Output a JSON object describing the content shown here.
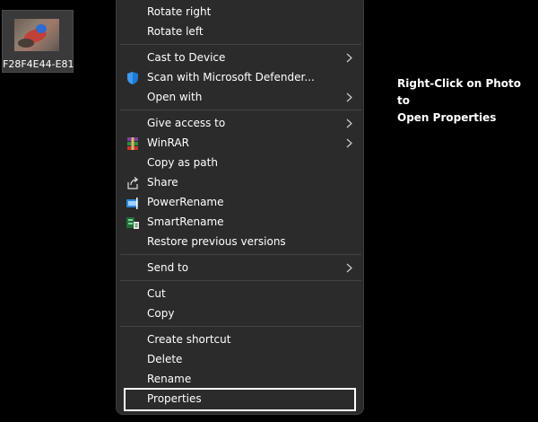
{
  "desktop": {
    "file": {
      "label": "F28F4E44-E81"
    }
  },
  "context_menu": {
    "items": [
      {
        "label": "Rotate right",
        "icon": "none",
        "submenu": false
      },
      {
        "label": "Rotate left",
        "icon": "none",
        "submenu": false
      },
      {
        "label": "Cast to Device",
        "icon": "none",
        "submenu": true
      },
      {
        "label": "Scan with Microsoft Defender...",
        "icon": "defender-shield-icon",
        "submenu": false
      },
      {
        "label": "Open with",
        "icon": "none",
        "submenu": true
      },
      {
        "label": "Give access to",
        "icon": "none",
        "submenu": true
      },
      {
        "label": "WinRAR",
        "icon": "winrar-icon",
        "submenu": true
      },
      {
        "label": "Copy as path",
        "icon": "none",
        "submenu": false
      },
      {
        "label": "Share",
        "icon": "share-icon",
        "submenu": false
      },
      {
        "label": "PowerRename",
        "icon": "powerrename-icon",
        "submenu": false
      },
      {
        "label": "SmartRename",
        "icon": "smartrename-icon",
        "submenu": false
      },
      {
        "label": "Restore previous versions",
        "icon": "none",
        "submenu": false
      },
      {
        "label": "Send to",
        "icon": "none",
        "submenu": true
      },
      {
        "label": "Cut",
        "icon": "none",
        "submenu": false
      },
      {
        "label": "Copy",
        "icon": "none",
        "submenu": false
      },
      {
        "label": "Create shortcut",
        "icon": "none",
        "submenu": false
      },
      {
        "label": "Delete",
        "icon": "none",
        "submenu": false
      },
      {
        "label": "Rename",
        "icon": "none",
        "submenu": false
      },
      {
        "label": "Properties",
        "icon": "none",
        "submenu": false,
        "highlighted": true
      }
    ]
  },
  "annotation": {
    "line1": "Right-Click on Photo to",
    "line2": "Open Properties"
  },
  "colors": {
    "menu_background": "#2b2b2b",
    "menu_text": "#ffffff",
    "separator": "#444444",
    "desktop_background": "#000000",
    "highlight_border": "#ffffff"
  }
}
